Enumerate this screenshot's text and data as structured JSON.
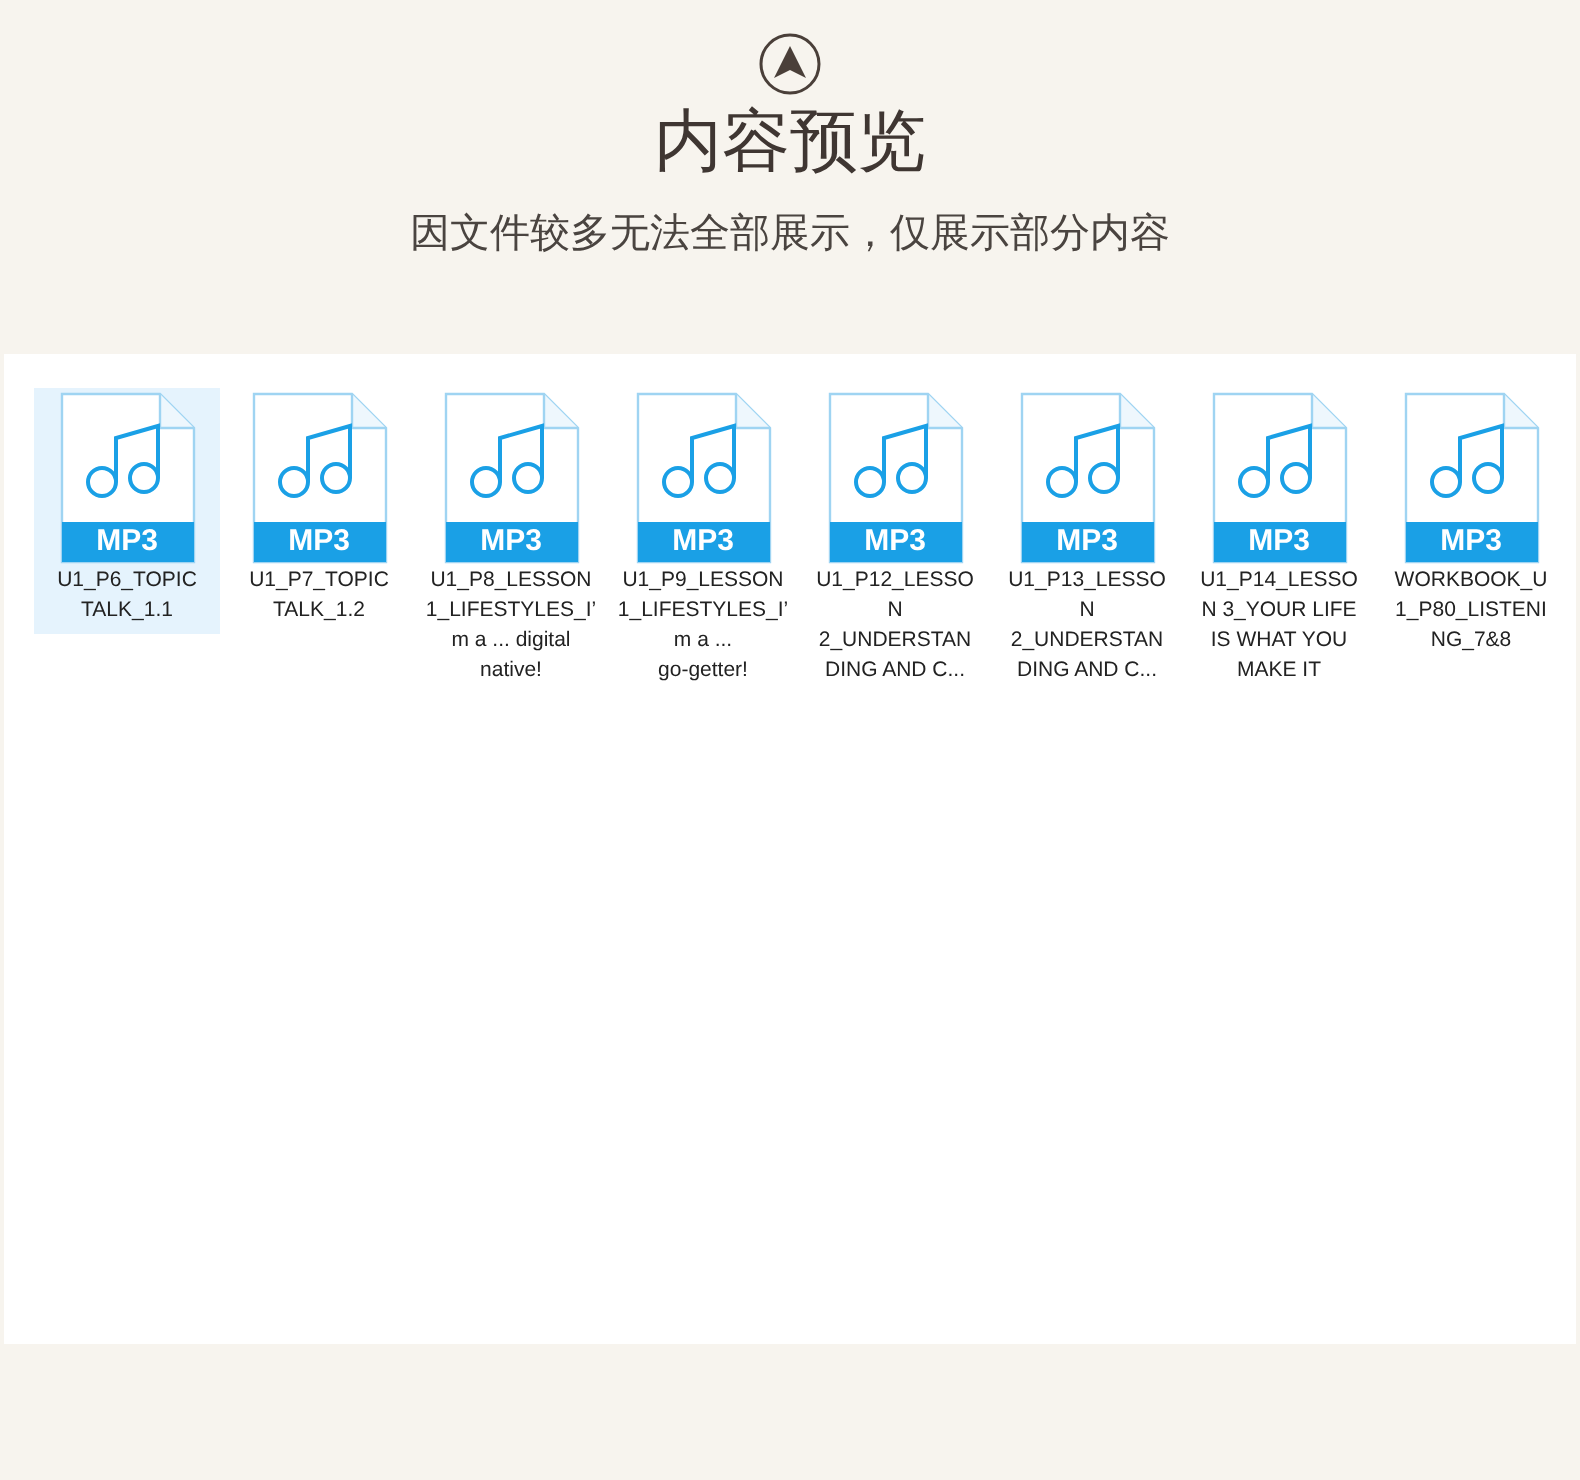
{
  "header": {
    "title": "内容预览",
    "subtitle": "因文件较多无法全部展示，仅展示部分内容"
  },
  "files": [
    {
      "badge": "MP3",
      "name_lines": [
        "U1_P6_TOPIC",
        "TALK_1.1"
      ],
      "selected": true
    },
    {
      "badge": "MP3",
      "name_lines": [
        "U1_P7_TOPIC",
        "TALK_1.2"
      ],
      "selected": false
    },
    {
      "badge": "MP3",
      "name_lines": [
        "U1_P8_LESSON",
        "1_LIFESTYLES_I’",
        "m a ... digital",
        "native!"
      ],
      "selected": false
    },
    {
      "badge": "MP3",
      "name_lines": [
        "U1_P9_LESSON",
        "1_LIFESTYLES_I’",
        "m a ...",
        "go-getter!"
      ],
      "selected": false
    },
    {
      "badge": "MP3",
      "name_lines": [
        "U1_P12_LESSO",
        "N",
        "2_UNDERSTAN",
        "DING AND C..."
      ],
      "selected": false
    },
    {
      "badge": "MP3",
      "name_lines": [
        "U1_P13_LESSO",
        "N",
        "2_UNDERSTAN",
        "DING AND C..."
      ],
      "selected": false
    },
    {
      "badge": "MP3",
      "name_lines": [
        "U1_P14_LESSO",
        "N 3_YOUR LIFE",
        "IS WHAT YOU",
        "MAKE IT"
      ],
      "selected": false
    },
    {
      "badge": "MP3",
      "name_lines": [
        "WORKBOOK_U",
        "1_P80_LISTENI",
        "NG_7&8"
      ],
      "selected": false
    }
  ]
}
